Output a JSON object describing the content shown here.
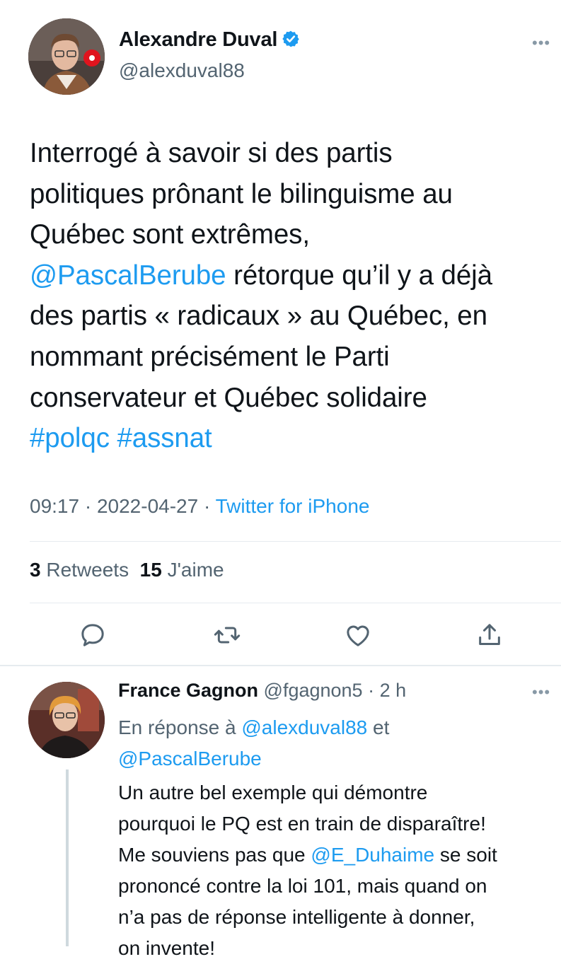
{
  "tweet": {
    "author_name": "Alexandre Duval",
    "author_handle": "@alexduval88",
    "more_icon": "ellipsis-icon",
    "verified_icon": "verified-badge-icon",
    "body_lines": [
      [
        "Interrogé à savoir si des partis"
      ],
      [
        "politiques prônant le bilinguisme au"
      ],
      [
        "Québec sont extrêmes,"
      ],
      [
        "@PascalBerube",
        " rétorque qu’il y a déjà"
      ],
      [
        "des partis « radicaux » au Québec, en"
      ],
      [
        "nommant précisément le Parti"
      ],
      [
        "conservateur et Québec solidaire"
      ],
      [
        "#polqc",
        "#assnat"
      ]
    ],
    "mention": "@PascalBerube",
    "hashtag_1": "#polqc",
    "hashtag_2": "#assnat",
    "time": "09:17",
    "date": "2022-04-27",
    "source": "Twitter for iPhone",
    "retweets_count": "3",
    "retweets_label": "Retweets",
    "likes_count": "15",
    "likes_label": "J'aime",
    "actions": [
      "reply-icon",
      "retweet-icon",
      "like-icon",
      "share-icon"
    ]
  },
  "reply": {
    "author_name": "France Gagnon",
    "author_handle": "@fgagnon5",
    "time": "2 h",
    "reply_to_prefix": "En réponse à",
    "reply_to_user_1": "@alexduval88",
    "reply_to_and": "et",
    "reply_to_user_2": "@PascalBerube",
    "body_line_1": "Un autre bel exemple qui démontre",
    "body_line_2": "pourquoi le PQ est en train de disparaître!",
    "body_line_3_a": "Me souviens pas que",
    "body_line_3_mention": "@E_Duhaime",
    "body_line_3_b": "se soit",
    "body_line_4": "prononcé contre la loi 101, mais quand on",
    "body_line_5": "n’a pas de réponse intelligente à donner,",
    "body_line_6": "on invente!"
  },
  "colors": {
    "link": "#1d9bf0",
    "secondary_text": "#536471",
    "primary_text": "#0f1419",
    "divider": "#e6ebef"
  }
}
